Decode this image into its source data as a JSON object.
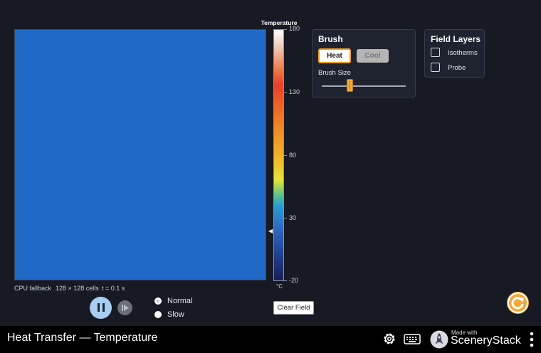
{
  "field": {
    "status_backend": "CPU fallback",
    "status_grid": "128 × 128 cells",
    "status_time": "t = 0.1 s",
    "color": "#2069c6"
  },
  "colorbar": {
    "title": "Temperature",
    "ticks": [
      "180",
      "130",
      "80",
      "30",
      "-20"
    ],
    "unit": "°C",
    "marker": "◀"
  },
  "brush": {
    "title": "Brush",
    "heat_label": "Heat",
    "cool_label": "Cool",
    "size_label": "Brush Size",
    "selected_mode": "Heat",
    "size_value": 0.33
  },
  "layers": {
    "title": "Field Layers",
    "items": [
      {
        "label": "Isotherms",
        "checked": false
      },
      {
        "label": "Probe",
        "checked": false
      }
    ]
  },
  "playback": {
    "speeds": [
      {
        "label": "Normal",
        "selected": true
      },
      {
        "label": "Slow",
        "selected": false
      }
    ],
    "clear_label": "Clear Field"
  },
  "navbar": {
    "title": "Heat Transfer — Temperature",
    "made_with": "Made with",
    "brand": "SceneryStack"
  },
  "colors": {
    "background": "#171a23",
    "accent": "#f3a93a",
    "play_button": "#a8cef2"
  }
}
